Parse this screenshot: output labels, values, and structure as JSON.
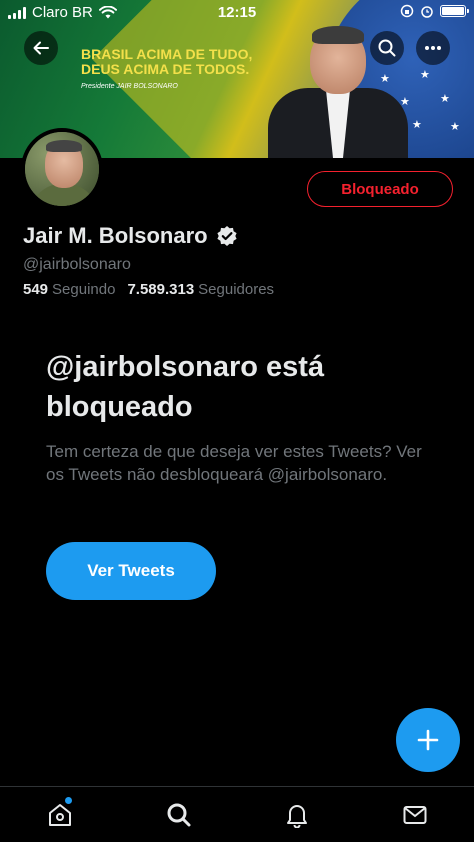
{
  "status_bar": {
    "carrier": "Claro BR",
    "time": "12:15"
  },
  "banner": {
    "line1": "BRASIL ACIMA DE TUDO,",
    "line2": "DEUS ACIMA DE TODOS.",
    "attribution": "Presidente JAIR BOLSONARO"
  },
  "profile": {
    "name": "Jair M. Bolsonaro",
    "handle": "@jairbolsonaro",
    "following_count": "549",
    "following_label": "Seguindo",
    "followers_count": "7.589.313",
    "followers_label": "Seguidores",
    "blocked_button": "Bloqueado"
  },
  "blocked_notice": {
    "title": "@jairbolsonaro está bloqueado",
    "description": "Tem certeza de que deseja ver estes Tweets? Ver os Tweets não desbloqueará @jairbolsonaro.",
    "view_button": "Ver Tweets"
  },
  "colors": {
    "accent": "#1d9bf0",
    "danger": "#f4212e",
    "muted": "#71767b",
    "background": "#000000"
  },
  "icons": {
    "back": "arrow-left-icon",
    "search": "search-icon",
    "more": "more-horizontal-icon",
    "verified": "verified-badge-icon",
    "compose": "plus-icon",
    "home": "home-icon",
    "explore": "search-icon",
    "notifications": "bell-icon",
    "messages": "mail-icon"
  }
}
